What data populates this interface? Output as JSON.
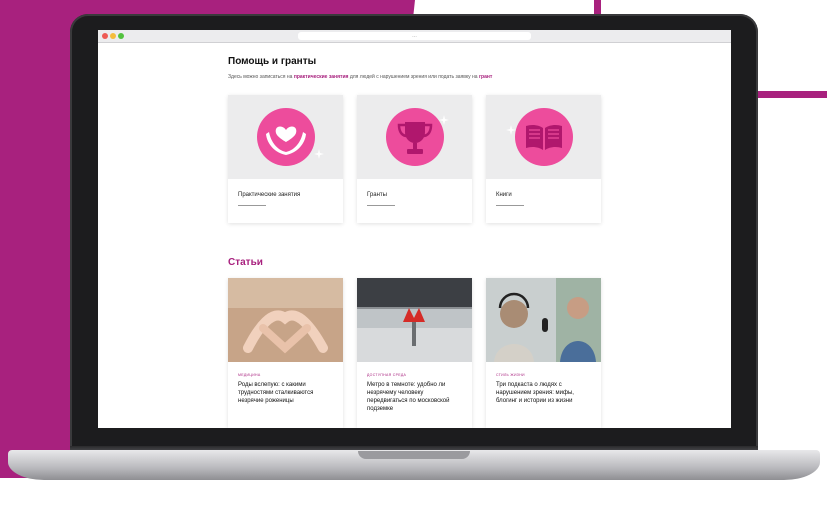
{
  "page": {
    "browser_url": "…",
    "help": {
      "title": "Помощь и гранты",
      "desc_1": "Здесь можно записаться на ",
      "desc_link_1": "практические занятия",
      "desc_2": " для людей с нарушением зрения или подать заявку на ",
      "desc_link_2": "грант"
    },
    "cards": [
      {
        "label": "Практические занятия",
        "icon": "heart-hands-icon"
      },
      {
        "label": "Гранты",
        "icon": "trophy-icon"
      },
      {
        "label": "Книги",
        "icon": "book-icon"
      }
    ],
    "articles_title": "Статьи",
    "articles": [
      {
        "category": "Медицина",
        "title": "Роды вслепую: с какими трудностями сталкиваются незрячие роженицы"
      },
      {
        "category": "Доступная среда",
        "title": "Метро в темноте: удобно ли незрячему человеку передвигаться по московской подземке"
      },
      {
        "category": "Стиль жизни",
        "title": "Три подкаста о людях с нарушением зрения: мифы, блогинг и истории из жизни"
      }
    ]
  },
  "colors": {
    "brand": "#a8217e",
    "pink": "#ed4c9c",
    "card_bg": "#ececed"
  }
}
